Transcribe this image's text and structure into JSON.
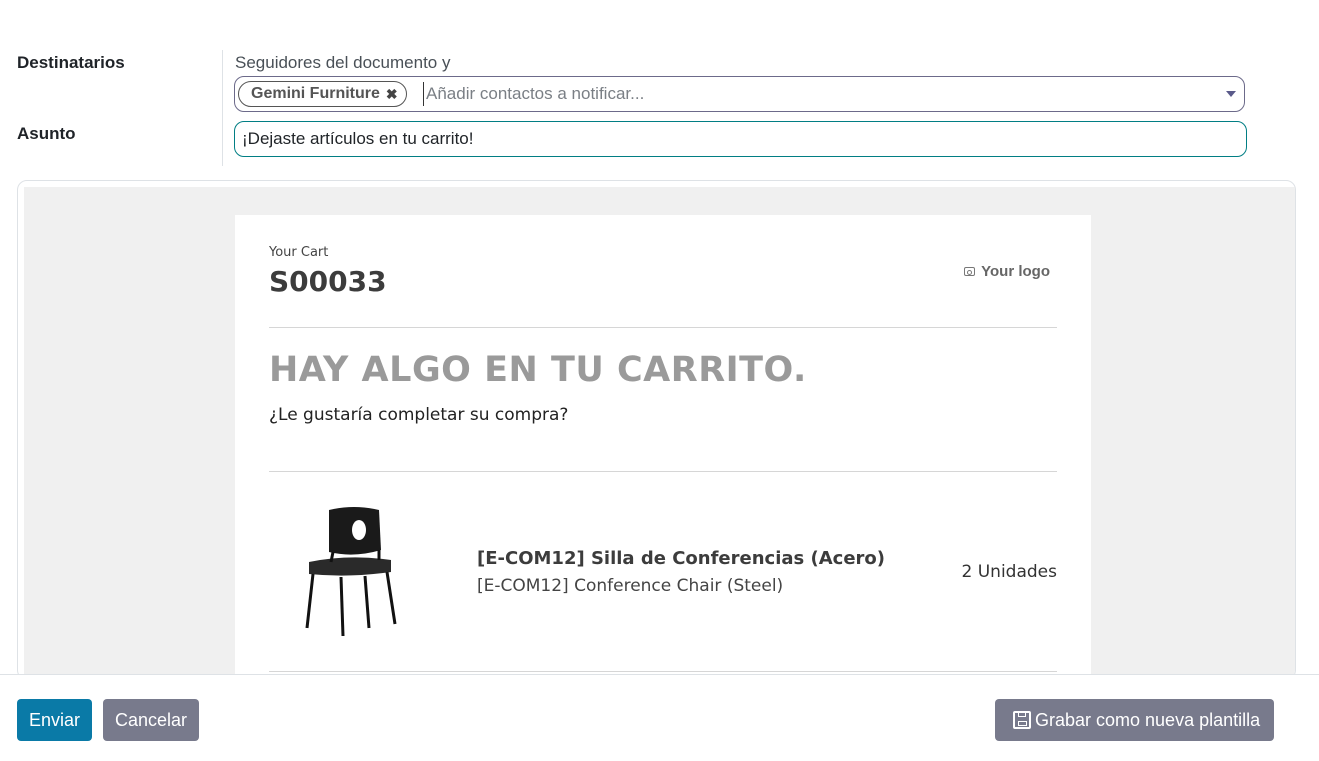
{
  "form": {
    "recipients_label": "Destinatarios",
    "subject_label": "Asunto",
    "followers_text": "Seguidores del documento y",
    "recipient_tag": "Gemini Furniture",
    "recipient_placeholder": "Añadir contactos a notificar...",
    "subject_value": "¡Dejaste artículos en tu carrito!"
  },
  "email": {
    "cart_label": "Your Cart",
    "order_ref": "S00033",
    "logo_text": "Your logo",
    "headline": "HAY ALGO EN TU CARRITO.",
    "question": "¿Le gustaría completar su compra?",
    "product": {
      "name": "[E-COM12] Silla de Conferencias (Acero)",
      "description": "[E-COM12] Conference Chair (Steel)",
      "quantity": "2 Unidades"
    }
  },
  "footer": {
    "send_label": "Enviar",
    "cancel_label": "Cancelar",
    "save_template_label": "Grabar como nueva plantilla"
  },
  "colors": {
    "primary": "#0a7aa7",
    "secondary": "#787a8c",
    "subject_border": "#017e84"
  }
}
